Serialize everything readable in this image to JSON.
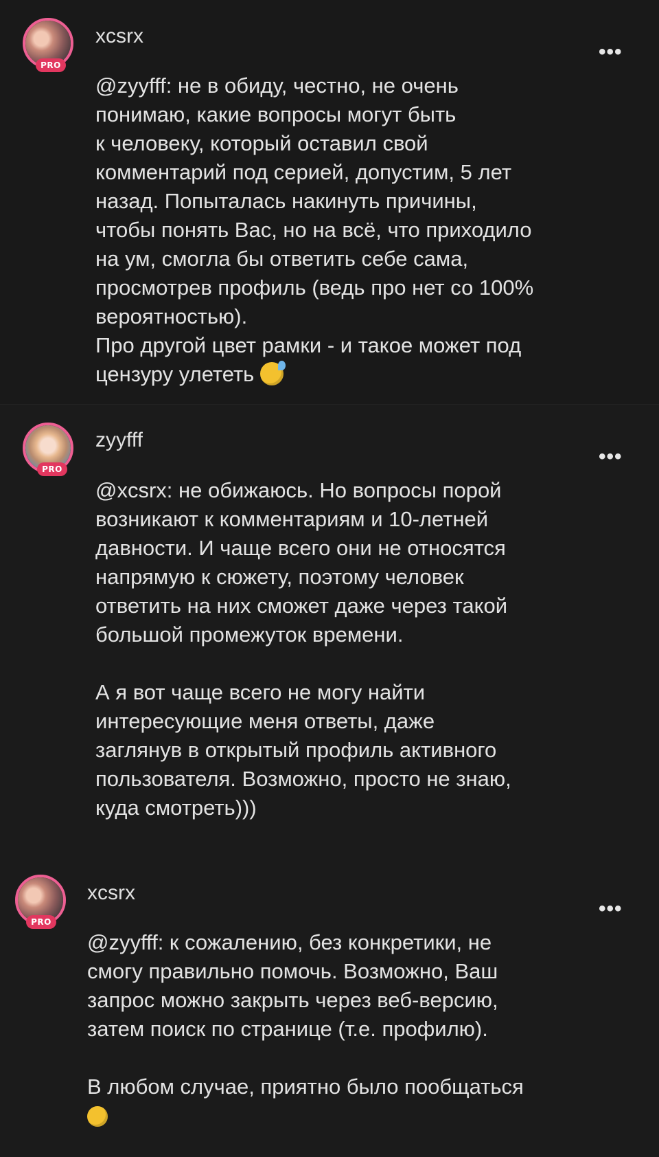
{
  "comments": [
    {
      "username": "xcsrx",
      "badge": "PRO",
      "more": "•••",
      "lines": [
        "@zyyfff: не в обиду, честно, не очень",
        "понимаю, какие вопросы могут быть",
        "к человеку, который оставил свой",
        "комментарий под серией, допустим, 5 лет",
        "назад. Попыталась накинуть причины,",
        "чтобы понять Вас, но на всё, что приходило",
        "на ум, смогла бы ответить себе сама,",
        "просмотрев профиль (ведь про нет со 100%",
        "вероятностью).",
        "Про другой цвет рамки - и такое может под",
        "цензуру улететь"
      ],
      "emoji": "grinning-sweat-emoji"
    },
    {
      "username": "zyyfff",
      "badge": "PRO",
      "more": "•••",
      "lines": [
        "@xcsrx: не обижаюсь. Но вопросы порой",
        "возникают к комментариям и 10-летней",
        "давности. И чаще всего они не относятся",
        "напрямую к сюжету, поэтому человек",
        "ответить на них сможет даже через такой",
        "большой промежуток времени.",
        "",
        "А я вот чаще всего не могу найти",
        "интересующие меня ответы, даже",
        "заглянув в открытый профиль активного",
        "пользователя. Возможно, просто не знаю,",
        "куда смотреть)))"
      ]
    },
    {
      "username": "xcsrx",
      "badge": "PRO",
      "more": "•••",
      "lines": [
        "@zyyfff: к сожалению, без конкретики, не",
        "смогу правильно помочь. Возможно, Ваш",
        "запрос можно закрыть через веб-версию,",
        "затем поиск по странице (т.е. профилю).",
        "",
        "В любом случае, приятно было пообщаться"
      ],
      "emoji": "sleepy-face-emoji"
    }
  ]
}
